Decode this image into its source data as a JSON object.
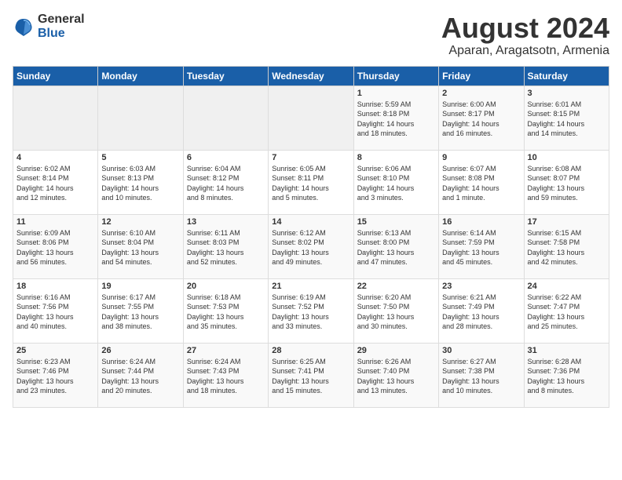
{
  "logo": {
    "general": "General",
    "blue": "Blue"
  },
  "title": "August 2024",
  "subtitle": "Aparan, Aragatsotn, Armenia",
  "days_of_week": [
    "Sunday",
    "Monday",
    "Tuesday",
    "Wednesday",
    "Thursday",
    "Friday",
    "Saturday"
  ],
  "weeks": [
    [
      {
        "day": "",
        "info": ""
      },
      {
        "day": "",
        "info": ""
      },
      {
        "day": "",
        "info": ""
      },
      {
        "day": "",
        "info": ""
      },
      {
        "day": "1",
        "info": "Sunrise: 5:59 AM\nSunset: 8:18 PM\nDaylight: 14 hours\nand 18 minutes."
      },
      {
        "day": "2",
        "info": "Sunrise: 6:00 AM\nSunset: 8:17 PM\nDaylight: 14 hours\nand 16 minutes."
      },
      {
        "day": "3",
        "info": "Sunrise: 6:01 AM\nSunset: 8:15 PM\nDaylight: 14 hours\nand 14 minutes."
      }
    ],
    [
      {
        "day": "4",
        "info": "Sunrise: 6:02 AM\nSunset: 8:14 PM\nDaylight: 14 hours\nand 12 minutes."
      },
      {
        "day": "5",
        "info": "Sunrise: 6:03 AM\nSunset: 8:13 PM\nDaylight: 14 hours\nand 10 minutes."
      },
      {
        "day": "6",
        "info": "Sunrise: 6:04 AM\nSunset: 8:12 PM\nDaylight: 14 hours\nand 8 minutes."
      },
      {
        "day": "7",
        "info": "Sunrise: 6:05 AM\nSunset: 8:11 PM\nDaylight: 14 hours\nand 5 minutes."
      },
      {
        "day": "8",
        "info": "Sunrise: 6:06 AM\nSunset: 8:10 PM\nDaylight: 14 hours\nand 3 minutes."
      },
      {
        "day": "9",
        "info": "Sunrise: 6:07 AM\nSunset: 8:08 PM\nDaylight: 14 hours\nand 1 minute."
      },
      {
        "day": "10",
        "info": "Sunrise: 6:08 AM\nSunset: 8:07 PM\nDaylight: 13 hours\nand 59 minutes."
      }
    ],
    [
      {
        "day": "11",
        "info": "Sunrise: 6:09 AM\nSunset: 8:06 PM\nDaylight: 13 hours\nand 56 minutes."
      },
      {
        "day": "12",
        "info": "Sunrise: 6:10 AM\nSunset: 8:04 PM\nDaylight: 13 hours\nand 54 minutes."
      },
      {
        "day": "13",
        "info": "Sunrise: 6:11 AM\nSunset: 8:03 PM\nDaylight: 13 hours\nand 52 minutes."
      },
      {
        "day": "14",
        "info": "Sunrise: 6:12 AM\nSunset: 8:02 PM\nDaylight: 13 hours\nand 49 minutes."
      },
      {
        "day": "15",
        "info": "Sunrise: 6:13 AM\nSunset: 8:00 PM\nDaylight: 13 hours\nand 47 minutes."
      },
      {
        "day": "16",
        "info": "Sunrise: 6:14 AM\nSunset: 7:59 PM\nDaylight: 13 hours\nand 45 minutes."
      },
      {
        "day": "17",
        "info": "Sunrise: 6:15 AM\nSunset: 7:58 PM\nDaylight: 13 hours\nand 42 minutes."
      }
    ],
    [
      {
        "day": "18",
        "info": "Sunrise: 6:16 AM\nSunset: 7:56 PM\nDaylight: 13 hours\nand 40 minutes."
      },
      {
        "day": "19",
        "info": "Sunrise: 6:17 AM\nSunset: 7:55 PM\nDaylight: 13 hours\nand 38 minutes."
      },
      {
        "day": "20",
        "info": "Sunrise: 6:18 AM\nSunset: 7:53 PM\nDaylight: 13 hours\nand 35 minutes."
      },
      {
        "day": "21",
        "info": "Sunrise: 6:19 AM\nSunset: 7:52 PM\nDaylight: 13 hours\nand 33 minutes."
      },
      {
        "day": "22",
        "info": "Sunrise: 6:20 AM\nSunset: 7:50 PM\nDaylight: 13 hours\nand 30 minutes."
      },
      {
        "day": "23",
        "info": "Sunrise: 6:21 AM\nSunset: 7:49 PM\nDaylight: 13 hours\nand 28 minutes."
      },
      {
        "day": "24",
        "info": "Sunrise: 6:22 AM\nSunset: 7:47 PM\nDaylight: 13 hours\nand 25 minutes."
      }
    ],
    [
      {
        "day": "25",
        "info": "Sunrise: 6:23 AM\nSunset: 7:46 PM\nDaylight: 13 hours\nand 23 minutes."
      },
      {
        "day": "26",
        "info": "Sunrise: 6:24 AM\nSunset: 7:44 PM\nDaylight: 13 hours\nand 20 minutes."
      },
      {
        "day": "27",
        "info": "Sunrise: 6:24 AM\nSunset: 7:43 PM\nDaylight: 13 hours\nand 18 minutes."
      },
      {
        "day": "28",
        "info": "Sunrise: 6:25 AM\nSunset: 7:41 PM\nDaylight: 13 hours\nand 15 minutes."
      },
      {
        "day": "29",
        "info": "Sunrise: 6:26 AM\nSunset: 7:40 PM\nDaylight: 13 hours\nand 13 minutes."
      },
      {
        "day": "30",
        "info": "Sunrise: 6:27 AM\nSunset: 7:38 PM\nDaylight: 13 hours\nand 10 minutes."
      },
      {
        "day": "31",
        "info": "Sunrise: 6:28 AM\nSunset: 7:36 PM\nDaylight: 13 hours\nand 8 minutes."
      }
    ]
  ]
}
